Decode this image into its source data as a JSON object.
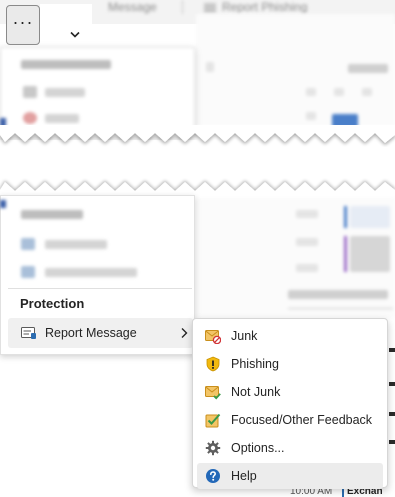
{
  "ribbon": {
    "ghost_message": "Message",
    "ghost_report_phishing": "Report Phishing"
  },
  "more_button": {
    "label": "···"
  },
  "protection": {
    "heading": "Protection",
    "report_message_label": "Report Message"
  },
  "submenu": {
    "items": [
      {
        "id": "junk",
        "label": "Junk",
        "icon": "junk-envelope-icon"
      },
      {
        "id": "phishing",
        "label": "Phishing",
        "icon": "shield-warning-icon"
      },
      {
        "id": "not-junk",
        "label": "Not Junk",
        "icon": "envelope-check-icon"
      },
      {
        "id": "focused",
        "label": "Focused/Other Feedback",
        "icon": "checkbox-icon"
      },
      {
        "id": "options",
        "label": "Options...",
        "icon": "gear-icon"
      },
      {
        "id": "help",
        "label": "Help",
        "icon": "help-icon"
      }
    ]
  },
  "right_edge": {
    "time": "10:00 AM",
    "exchange": "Exchan"
  },
  "colors": {
    "accent_blue": "#2b6cb0",
    "shield_yellow": "#f2b90f",
    "envelope_gold": "#e8b14a",
    "check_green": "#3a9a48",
    "help_blue": "#2368b8"
  }
}
